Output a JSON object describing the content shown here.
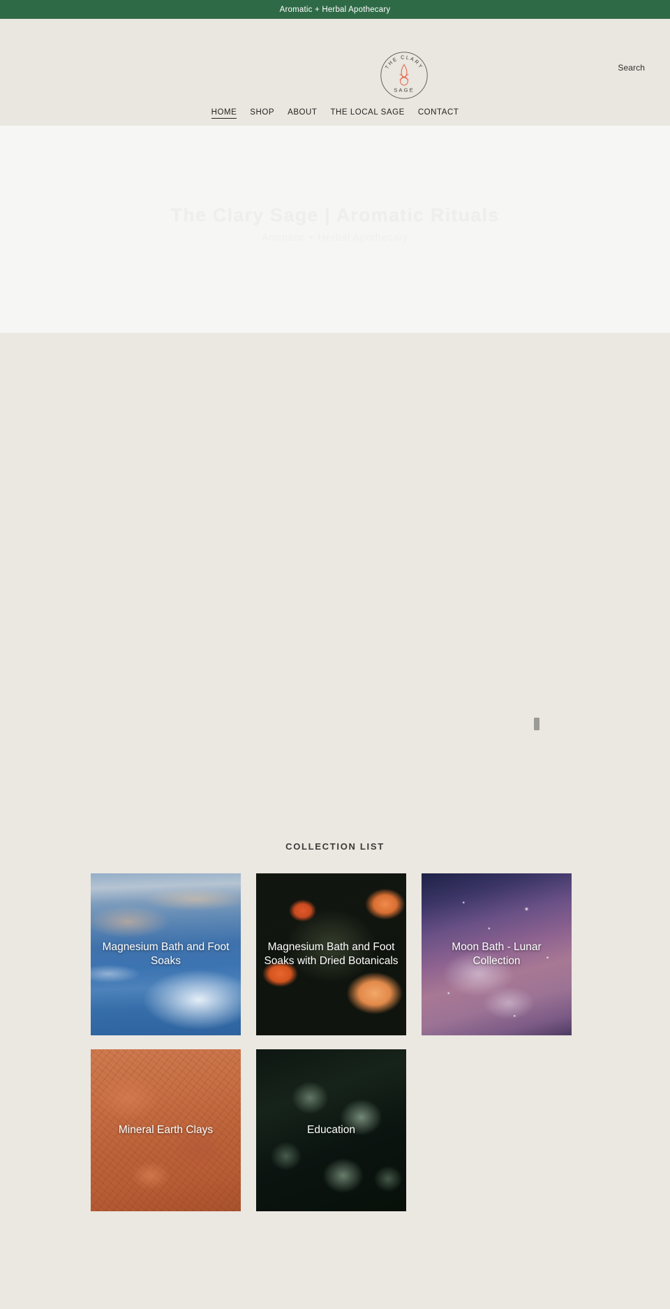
{
  "announcement": {
    "text": "Aromatic + Herbal Apothecary",
    "background": "#2f6a46"
  },
  "header": {
    "logo": {
      "top_text": "THE CLARY",
      "bottom_text": "SAGE",
      "mark": "flame-icon",
      "mark_color": "#e4684a",
      "outline_color": "#55544f"
    },
    "search_label": "Search",
    "background": "#eae6e0",
    "nav": [
      {
        "label": "HOME",
        "active": true
      },
      {
        "label": "SHOP",
        "active": false
      },
      {
        "label": "ABOUT",
        "active": false
      },
      {
        "label": "THE LOCAL SAGE",
        "active": false
      },
      {
        "label": "CONTACT",
        "active": false
      }
    ]
  },
  "hero": {
    "title": "The Clary Sage | Aromatic Rituals",
    "subtitle": "Aromatic + Herbal Apothecary",
    "background": "#f6f6f5",
    "text_color": "#eeeeee"
  },
  "collections": {
    "heading": "COLLECTION LIST",
    "items": [
      {
        "title": "Magnesium Bath and Foot Soaks",
        "art": "img-ice"
      },
      {
        "title": "Magnesium Bath and Foot Soaks with Dried Botanicals",
        "art": "img-roses"
      },
      {
        "title": "Moon Bath - Lunar Collection",
        "art": "img-galaxy"
      },
      {
        "title": "Mineral Earth Clays",
        "art": "img-clay"
      },
      {
        "title": "Education",
        "art": "img-leaves"
      }
    ]
  }
}
